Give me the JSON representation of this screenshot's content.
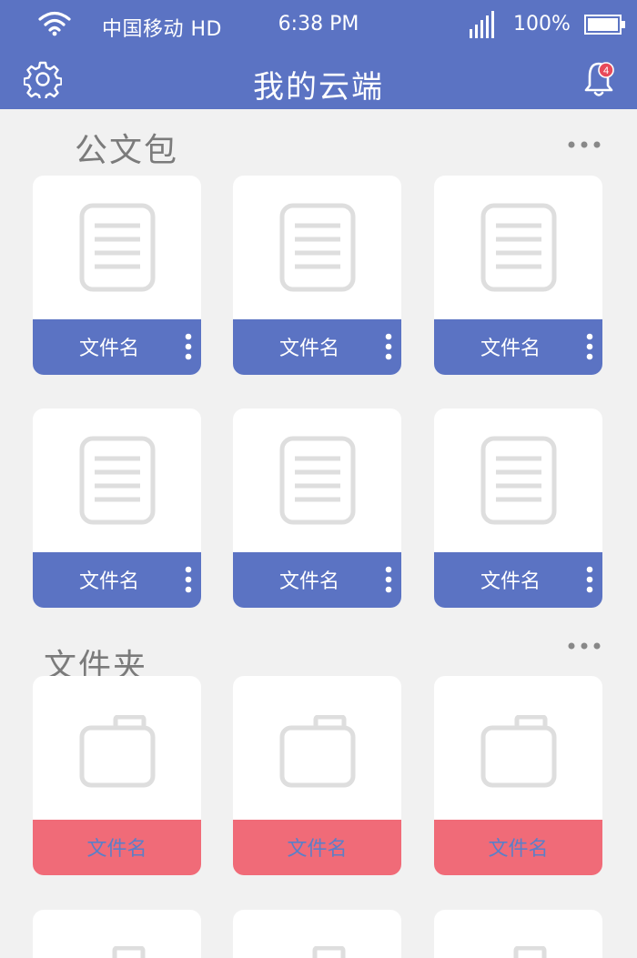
{
  "status_bar": {
    "carrier": "中国移动 HD",
    "time": "6:38 PM",
    "battery_percent": "100%"
  },
  "header": {
    "title": "我的云端",
    "notification_count": "4"
  },
  "colors": {
    "primary": "#5b73c3",
    "folder_accent": "#f06b78",
    "folder_label": "#5b7fc8",
    "background": "#f1f1f1",
    "notification_badge": "#e84a5a"
  },
  "sections": [
    {
      "title": "公文包",
      "icon": "document-icon",
      "items": [
        {
          "label": "文件名"
        },
        {
          "label": "文件名"
        },
        {
          "label": "文件名"
        },
        {
          "label": "文件名"
        },
        {
          "label": "文件名"
        },
        {
          "label": "文件名"
        }
      ]
    },
    {
      "title": "文件夹",
      "icon": "folder-icon",
      "items": [
        {
          "label": "文件名"
        },
        {
          "label": "文件名"
        },
        {
          "label": "文件名"
        }
      ]
    }
  ]
}
